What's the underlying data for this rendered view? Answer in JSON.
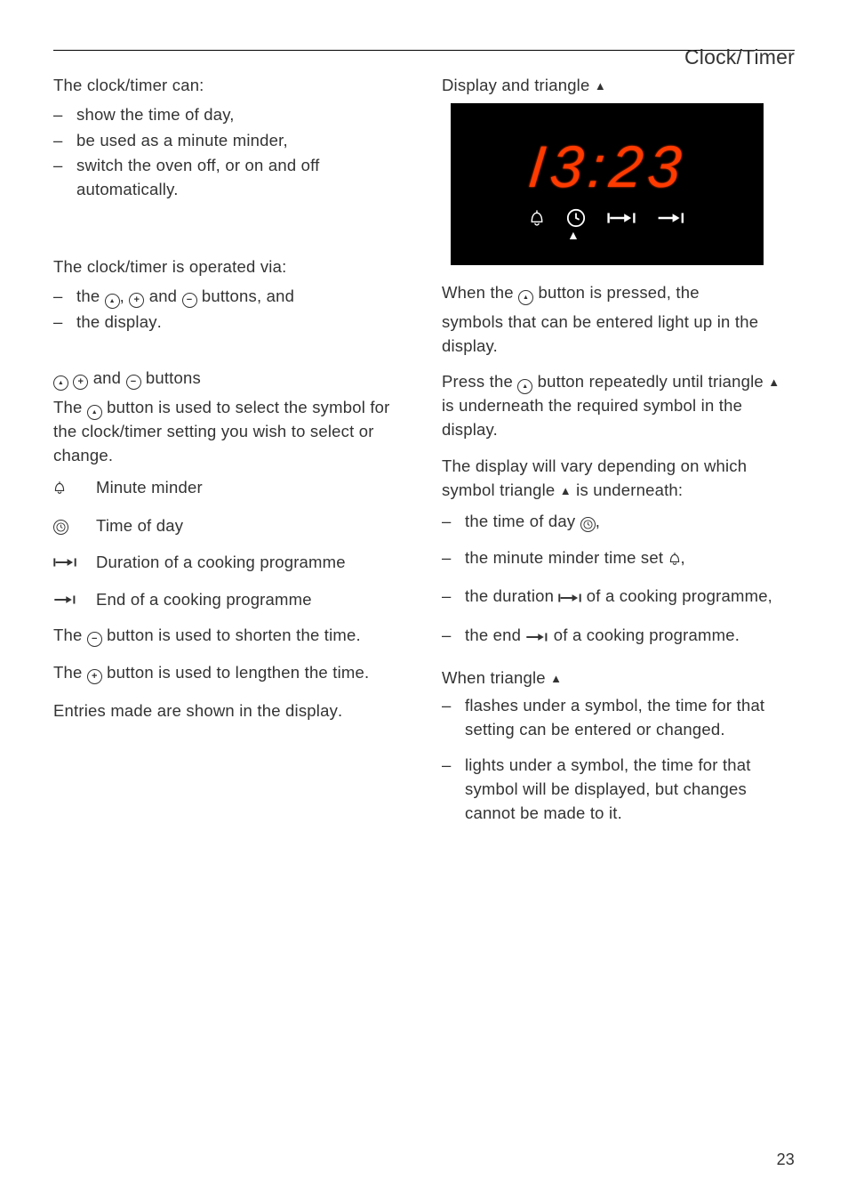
{
  "header": {
    "page_title": "Clock/Timer"
  },
  "icons": {
    "up": "up-triangle",
    "plus": "plus",
    "minus": "minus",
    "clock": "clock",
    "bell": "bell",
    "arrow_duration": "duration-arrow",
    "arrow_end": "end-arrow",
    "triangle_filled": "filled-triangle"
  },
  "display": {
    "time": "I3:23",
    "icons": [
      "bell",
      "clock",
      "duration-arrow",
      "end-arrow"
    ],
    "pointer_under": "clock"
  },
  "left": {
    "intro": "The clock/timer can:",
    "can": [
      "show the time of day,",
      "be used as a minute minder,",
      "switch the oven off, or on and off automatically."
    ],
    "operated_intro": "The clock/timer is operated via:",
    "operated": [
      {
        "text_parts": [
          "the ",
          "UP",
          ", ",
          "PLUS",
          " and ",
          "MINUS",
          " buttons",
          ", and"
        ]
      },
      {
        "text_parts": [
          "the ",
          "display"
        ]
      }
    ],
    "heading_parts": [
      "UP",
      " ",
      "PLUS",
      " and ",
      "MINUS",
      " buttons"
    ],
    "up_desc_parts": [
      "The ",
      "UP",
      " button",
      " is used to select the symbol for the clock/timer setting you wish to select or change."
    ],
    "symbol_table": [
      {
        "sym": "bell",
        "label": "Minute minder"
      },
      {
        "sym": "clock",
        "label": "Time of day"
      },
      {
        "sym": "arrow_duration",
        "label": "Duration of a cooking programme"
      },
      {
        "sym": "arrow_end",
        "label": "End of a cooking programme"
      }
    ],
    "minus_desc_parts": [
      "The ",
      "MINUS",
      " button",
      " is used to shorten the time."
    ],
    "plus_desc_parts": [
      "The ",
      "PLUS",
      " button",
      " is used to lengthen the time."
    ],
    "entries_parts": [
      "Entries made are shown in the ",
      "display"
    ]
  },
  "right": {
    "heading_parts": [
      "Display and triangle ",
      "TRI"
    ],
    "pressed_parts": [
      "When the ",
      "UP",
      " button is pressed, the"
    ],
    "symbols_that": [
      "symbols",
      " that can be entered light up in the display."
    ],
    "press_repeat_parts": [
      "Press the ",
      "UP",
      " button repeatedly until triangle ",
      "TRI",
      " is underneath the required symbol in the display."
    ],
    "vary_parts": [
      "The display will vary depending on which symbol triangle ",
      "TRI",
      " is underneath:"
    ],
    "vary_list": [
      {
        "parts": [
          "the time of day ",
          "CLOCK",
          ","
        ]
      },
      {
        "parts": [
          "the minute minder time set ",
          "BELL",
          ","
        ]
      },
      {
        "parts": [
          "the duration ",
          "DUR",
          " of a cooking programme,"
        ]
      },
      {
        "parts": [
          "the end ",
          "END",
          " of a cooking programme."
        ]
      }
    ],
    "when_heading_parts": [
      "When ",
      "triangle ",
      "TRI"
    ],
    "when_list": [
      {
        "lead": "flashes",
        "rest": " under a symbol, the time for that setting can be entered or changed."
      },
      {
        "lead": "lights",
        "rest": " under a symbol, the time for that symbol will be displayed, but changes cannot be made to it."
      }
    ]
  },
  "page_number": "23"
}
